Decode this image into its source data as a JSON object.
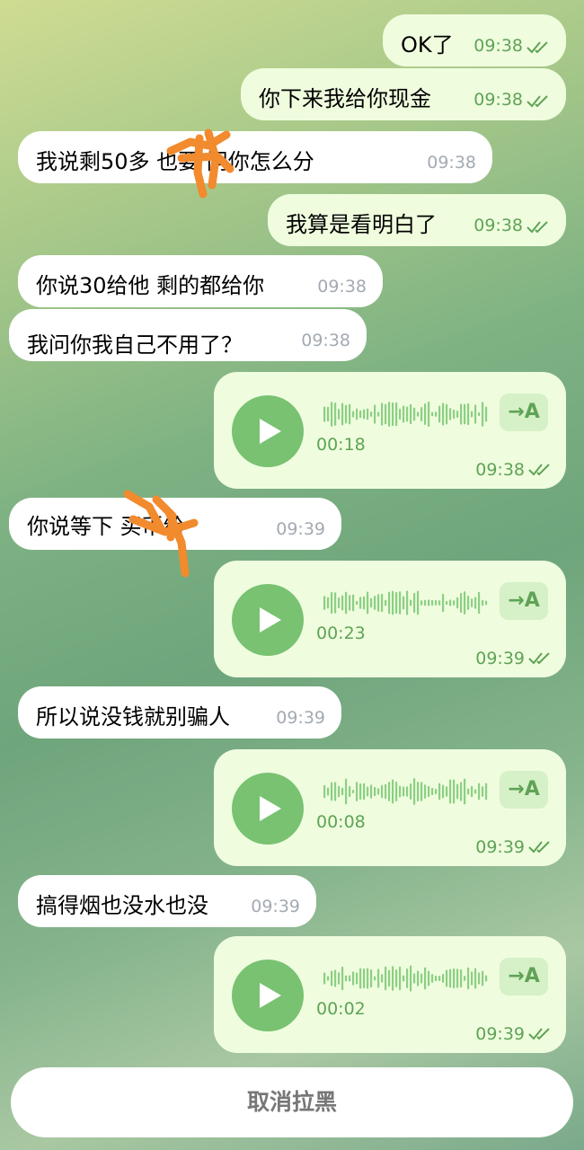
{
  "colors": {
    "incoming_bubble": "#ffffff",
    "outgoing_bubble": "#effdde",
    "accent": "#78c272",
    "scribble": "#f28a2e"
  },
  "messages": [
    {
      "dir": "out",
      "text": "OK了",
      "time": "09:38",
      "read": true
    },
    {
      "dir": "out",
      "text": "你下来我给你现金",
      "time": "09:38",
      "read": true
    },
    {
      "dir": "in",
      "text": "我说剩50多 也要 问你怎么分",
      "time": "09:38"
    },
    {
      "dir": "out",
      "text": "我算是看明白了",
      "time": "09:38",
      "read": true
    },
    {
      "dir": "in",
      "text": "你说30给他  剩的都给你",
      "time": "09:38"
    },
    {
      "dir": "in",
      "text": "我问你我自己不用了？",
      "time": "09:38"
    },
    {
      "dir": "out",
      "type": "voice",
      "duration": "00:18",
      "time": "09:38",
      "read": true,
      "transcribe_label": "→A"
    },
    {
      "dir": "in",
      "text": "你说等下   买币给",
      "time": "09:39"
    },
    {
      "dir": "out",
      "type": "voice",
      "duration": "00:23",
      "time": "09:39",
      "read": true,
      "transcribe_label": "→A"
    },
    {
      "dir": "in",
      "text": "所以说没钱就别骗人",
      "time": "09:39"
    },
    {
      "dir": "out",
      "type": "voice",
      "duration": "00:08",
      "time": "09:39",
      "read": true,
      "transcribe_label": "→A"
    },
    {
      "dir": "in",
      "text": "搞得烟也没水也没",
      "time": "09:39"
    },
    {
      "dir": "out",
      "type": "voice",
      "duration": "00:02",
      "time": "09:39",
      "read": true,
      "transcribe_label": "→A"
    }
  ],
  "footer": {
    "unblock_label": "取消拉黑"
  }
}
